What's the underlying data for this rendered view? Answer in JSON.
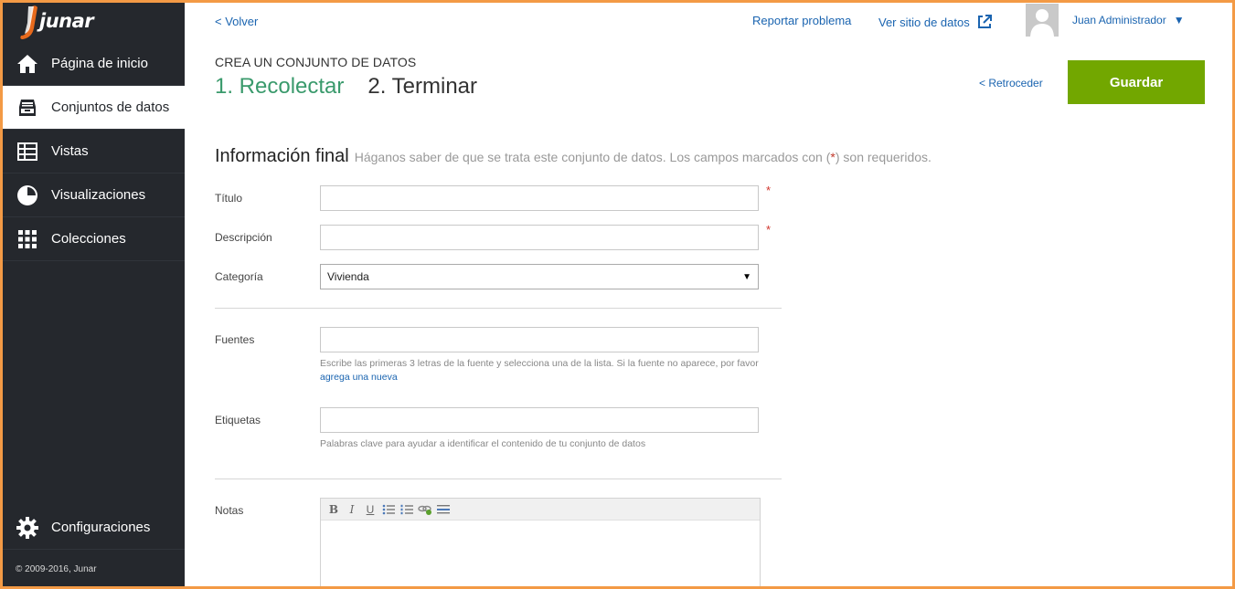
{
  "brand": {
    "logo_text": "junar"
  },
  "sidebar": {
    "items": [
      {
        "label": "Página de inicio",
        "icon": "home-icon"
      },
      {
        "label": "Conjuntos de datos",
        "icon": "inbox-icon",
        "active": true
      },
      {
        "label": "Vistas",
        "icon": "table-icon"
      },
      {
        "label": "Visualizaciones",
        "icon": "pie-chart-icon"
      },
      {
        "label": "Colecciones",
        "icon": "grid-icon"
      }
    ],
    "config_label": "Configuraciones",
    "copyright": "© 2009-2016, Junar"
  },
  "header": {
    "back_label": "< Volver",
    "report_label": "Reportar problema",
    "site_label": "Ver sitio de datos",
    "user_name": "Juan Administrador",
    "user_caret": "▼"
  },
  "wizard": {
    "eyebrow": "CREA UN CONJUNTO DE DATOS",
    "step1": "1. Recolectar",
    "step2": "2. Terminar",
    "retroceder_label": "< Retroceder",
    "save_label": "Guardar"
  },
  "form": {
    "title": "Información final",
    "hint_before": "Háganos saber de que se trata este conjunto de datos. Los campos marcados con (",
    "hint_star": "*",
    "hint_after": ") son requeridos.",
    "required_mark": "*",
    "titulo_label": "Título",
    "titulo_value": "",
    "descripcion_label": "Descripción",
    "descripcion_value": "",
    "categoria_label": "Categoría",
    "categoria_value": "Vivienda",
    "categoria_caret": "▼",
    "fuentes_label": "Fuentes",
    "fuentes_value": "",
    "fuentes_help": "Escribe las primeras 3 letras de la fuente y selecciona una de la lista. Si la fuente no aparece, por favor",
    "fuentes_help_link": "agrega una nueva",
    "etiquetas_label": "Etiquetas",
    "etiquetas_value": "",
    "etiquetas_help": "Palabras clave para ayudar a identificar el contenido de tu conjunto de datos",
    "notas_label": "Notas",
    "editor_bold": "B",
    "editor_italic": "I",
    "editor_underline": "U"
  },
  "colors": {
    "sidebar_bg": "#25282d",
    "accent_green": "#72a700",
    "step_active": "#3a9a6c",
    "link_blue": "#1a64b0",
    "frame_orange": "#f39a45"
  }
}
